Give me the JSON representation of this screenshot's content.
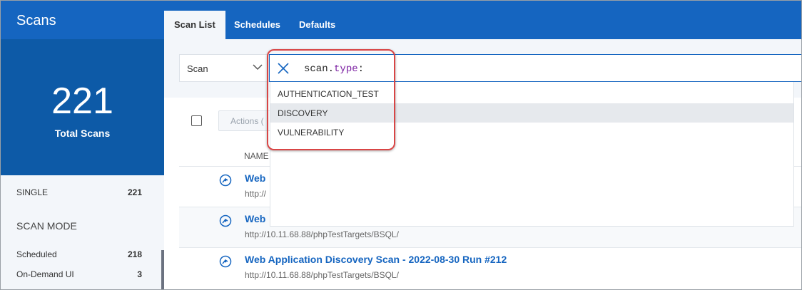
{
  "app": {
    "title": "Scans"
  },
  "tabs": [
    {
      "label": "Scan List",
      "active": true
    },
    {
      "label": "Schedules",
      "active": false
    },
    {
      "label": "Defaults",
      "active": false
    }
  ],
  "sidebar": {
    "total": {
      "value": "221",
      "label": "Total Scans"
    },
    "single": {
      "label": "SINGLE",
      "count": "221"
    },
    "scan_mode": {
      "heading": "SCAN MODE",
      "items": [
        {
          "label": "Scheduled",
          "count": "218"
        },
        {
          "label": "On-Demand UI",
          "count": "3"
        }
      ]
    }
  },
  "filter": {
    "field_select": "Scan",
    "query_key": "scan.",
    "query_field": "type",
    "query_suffix": ":",
    "suggestions": [
      {
        "label": "AUTHENTICATION_TEST",
        "highlighted": false
      },
      {
        "label": "DISCOVERY",
        "highlighted": true
      },
      {
        "label": "VULNERABILITY",
        "highlighted": false
      }
    ]
  },
  "toolbar": {
    "actions_label": "Actions ("
  },
  "table": {
    "column_name": "NAME",
    "rows": [
      {
        "title": "Web ",
        "url": "http://"
      },
      {
        "title": "Web ",
        "url": "http://10.11.68.88/phpTestTargets/BSQL/"
      },
      {
        "title": "Web Application Discovery Scan - 2022-08-30 Run #212",
        "url": "http://10.11.68.88/phpTestTargets/BSQL/"
      }
    ]
  },
  "colors": {
    "brand_blue": "#1565c0",
    "stat_blue": "#0d5aa7",
    "callout_red": "#d94545"
  },
  "icons": {
    "clear": "close-icon",
    "dropdown": "chevron-down-icon",
    "scan_type": "webapp-scan-icon"
  }
}
